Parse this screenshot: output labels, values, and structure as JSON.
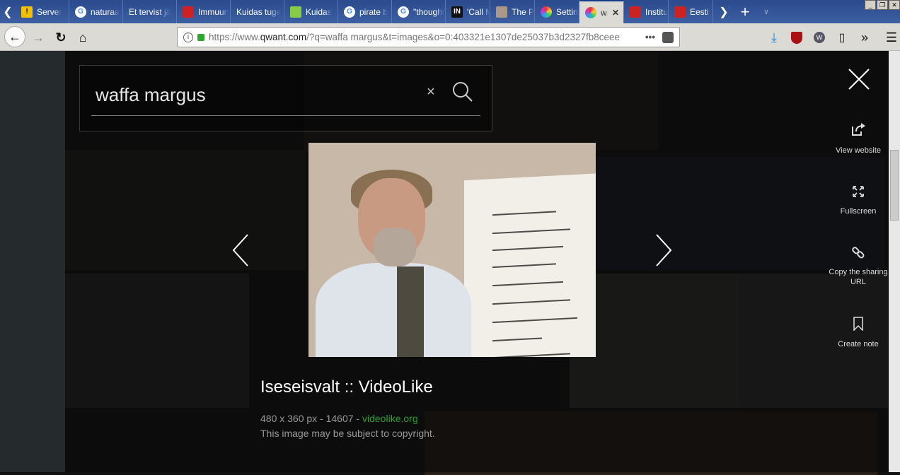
{
  "browser": {
    "tabs": [
      {
        "label": "Server",
        "icon": "warning-icon"
      },
      {
        "label": "naturaa",
        "icon": "google-icon"
      },
      {
        "label": "Et tervist jä",
        "icon": ""
      },
      {
        "label": "Immuun",
        "icon": "site-icon"
      },
      {
        "label": "Kuidas tuge",
        "icon": ""
      },
      {
        "label": "Kuidas",
        "icon": "plant-icon"
      },
      {
        "label": "pirate b",
        "icon": "google-icon"
      },
      {
        "label": "\"thought",
        "icon": "google-icon"
      },
      {
        "label": "'Call Me",
        "icon": "in-icon"
      },
      {
        "label": "The Pir",
        "icon": "pirate-icon"
      },
      {
        "label": "Settings",
        "icon": "qwant-icon"
      },
      {
        "label": "waf",
        "icon": "qwant-icon",
        "active": true
      },
      {
        "label": "Institu",
        "icon": "site-icon"
      },
      {
        "label": "Eesti R",
        "icon": "site-icon"
      }
    ],
    "url_prefix": "https://www.",
    "url_domain": "qwant.com",
    "url_rest": "/?q=waffa margus&t=images&o=0:403321e1307de25037b3d2327fb8ceee",
    "page_actions": "•••"
  },
  "search": {
    "query": "waffa margus",
    "clear": "×"
  },
  "viewer": {
    "title": "Iseseisvalt :: VideoLike",
    "meta": "480 x 360 px - 14607 - ",
    "source": "videolike.org",
    "copyright": "This image may be subject to copyright.",
    "actions": [
      {
        "label": "View website",
        "icon": "external-link-icon"
      },
      {
        "label": "Fullscreen",
        "icon": "fullscreen-icon"
      },
      {
        "label": "Copy the sharing URL",
        "icon": "link-icon"
      },
      {
        "label": "Create note",
        "icon": "bookmark-icon"
      }
    ]
  },
  "colors": {
    "tabbar": "#2a4a8c",
    "source_link": "#2aa02a"
  }
}
